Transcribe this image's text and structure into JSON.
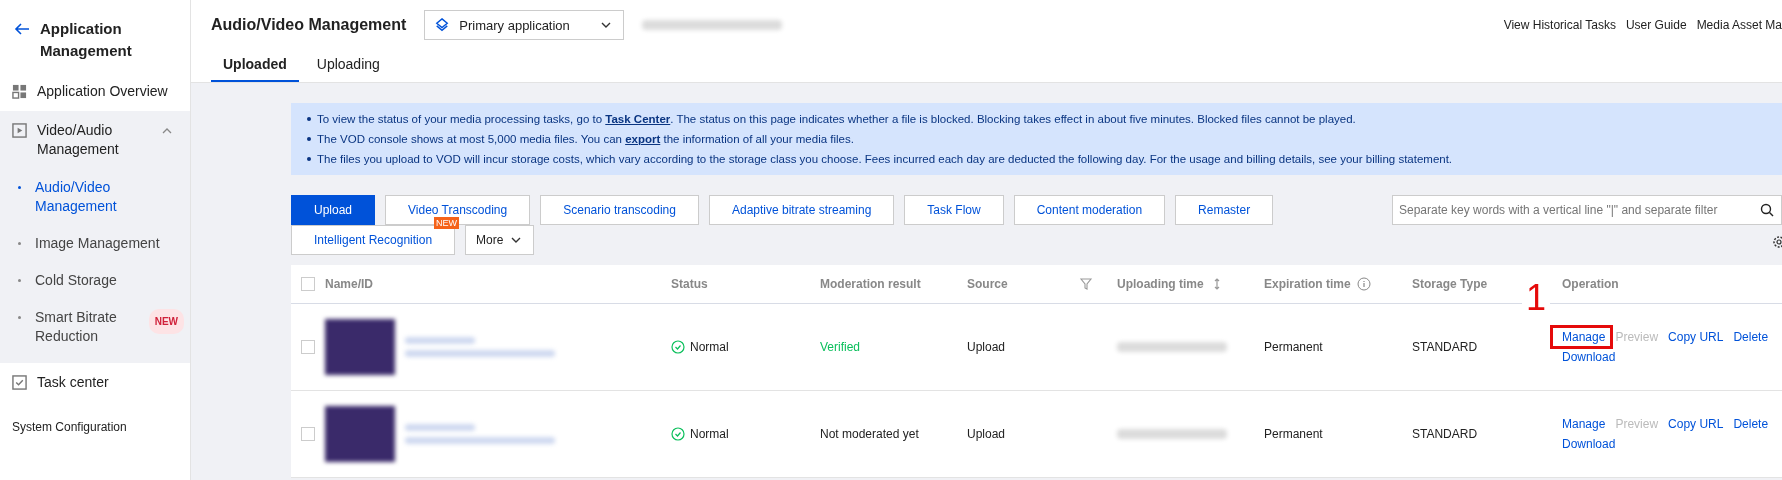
{
  "sidebar": {
    "back_title": "Application Management",
    "items": [
      {
        "label": "Application Overview",
        "expanded": false
      },
      {
        "label": "Video/Audio Management",
        "expanded": true,
        "children": [
          {
            "label": "Audio/Video Management",
            "selected": true
          },
          {
            "label": "Image Management",
            "selected": false
          },
          {
            "label": "Cold Storage",
            "selected": false
          },
          {
            "label": "Smart Bitrate Reduction",
            "selected": false,
            "badge": "NEW"
          }
        ]
      },
      {
        "label": "Task center",
        "expanded": false
      }
    ],
    "footer": "System Configuration"
  },
  "header": {
    "title": "Audio/Video Management",
    "app_select": "Primary application",
    "links": [
      "View Historical Tasks",
      "User Guide",
      "Media Asset Ma"
    ]
  },
  "tabs": [
    {
      "label": "Uploaded",
      "selected": true
    },
    {
      "label": "Uploading",
      "selected": false
    }
  ],
  "notice": [
    "To view the status of your media processing tasks, go to **Task Center**. The status on this page indicates whether a file is blocked. Blocking takes effect in about five minutes. Blocked files cannot be played.",
    "The VOD console shows at most 5,000 media files. You can **export** the information of all your media files.",
    "The files you upload to VOD will incur storage costs, which vary according to the storage class you choose. Fees incurred each day are deducted the following day. For the usage and billing details, see your billing statement."
  ],
  "toolbar": [
    {
      "label": "Upload",
      "kind": "primary"
    },
    {
      "label": "Video Transcoding",
      "kind": "default"
    },
    {
      "label": "Scenario transcoding",
      "kind": "default"
    },
    {
      "label": "Adaptive bitrate streaming",
      "kind": "default"
    },
    {
      "label": "Task Flow",
      "kind": "default"
    },
    {
      "label": "Content moderation",
      "kind": "default"
    },
    {
      "label": "Remaster",
      "kind": "default"
    },
    {
      "label": "Intelligent Recognition",
      "kind": "default",
      "badge": "NEW"
    },
    {
      "label": "More",
      "kind": "dropdown"
    }
  ],
  "search": {
    "placeholder": "Separate key words with a vertical line \"|\" and separate filter"
  },
  "table": {
    "columns": [
      "Name/ID",
      "Status",
      "Moderation result",
      "Source",
      "Uploading time",
      "Expiration time",
      "Storage Type",
      "Operation"
    ],
    "select_all_checked": false,
    "rows": [
      {
        "checked": false,
        "status": "Normal",
        "moderation": "Verified",
        "verified": true,
        "source": "Upload",
        "expiration": "Permanent",
        "storage": "STANDARD",
        "callout": "1",
        "operations": [
          {
            "label": "Manage",
            "disabled": false
          },
          {
            "label": "Preview",
            "disabled": true
          },
          {
            "label": "Copy URL",
            "disabled": false
          },
          {
            "label": "Delete",
            "disabled": false
          },
          {
            "label": "Download",
            "disabled": false
          }
        ]
      },
      {
        "checked": false,
        "status": "Normal",
        "moderation": "Not moderated yet",
        "verified": false,
        "source": "Upload",
        "expiration": "Permanent",
        "storage": "STANDARD",
        "operations": [
          {
            "label": "Manage",
            "disabled": false
          },
          {
            "label": "Preview",
            "disabled": true
          },
          {
            "label": "Copy URL",
            "disabled": false
          },
          {
            "label": "Delete",
            "disabled": false
          },
          {
            "label": "Download",
            "disabled": false
          }
        ]
      }
    ]
  }
}
